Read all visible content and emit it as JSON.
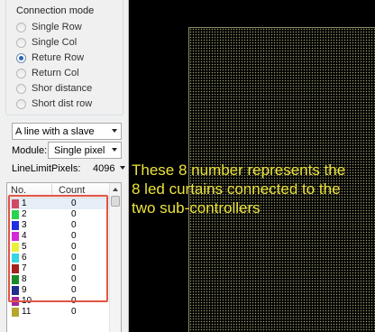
{
  "connection_mode": {
    "title": "Connection mode",
    "options": [
      {
        "label": "Single Row",
        "checked": false
      },
      {
        "label": "Single Col",
        "checked": false
      },
      {
        "label": "Reture Row",
        "checked": true
      },
      {
        "label": "Return Col",
        "checked": false
      },
      {
        "label": "Shor distance",
        "checked": false
      },
      {
        "label": "Short dist row",
        "checked": false
      }
    ]
  },
  "controls": {
    "line_mode_value": "A line with a slave",
    "module_label": "Module:",
    "module_value": "Single pixel",
    "line_limit_label": "LineLimitPixels:",
    "line_limit_value": "4096"
  },
  "list": {
    "header_no": "No.",
    "header_count": "Count",
    "rows": [
      {
        "no": "1",
        "count": "0",
        "color": "#d04a66",
        "selected": true
      },
      {
        "no": "2",
        "count": "0",
        "color": "#29d34f"
      },
      {
        "no": "3",
        "count": "0",
        "color": "#1f2fe0"
      },
      {
        "no": "4",
        "count": "0",
        "color": "#d32ad6"
      },
      {
        "no": "5",
        "count": "0",
        "color": "#eaf03a"
      },
      {
        "no": "6",
        "count": "0",
        "color": "#36d6e6"
      },
      {
        "no": "7",
        "count": "0",
        "color": "#a5221c"
      },
      {
        "no": "8",
        "count": "0",
        "color": "#1a8a2a"
      },
      {
        "no": "9",
        "count": "0",
        "color": "#1f2f90"
      },
      {
        "no": "10",
        "count": "0",
        "color": "#a2289c"
      },
      {
        "no": "11",
        "count": "0",
        "color": "#b8a52e"
      }
    ]
  },
  "annotation": {
    "lines": [
      "These 8 number represents the",
      " 8 led curtains connected to the",
      " two sub-controllers"
    ],
    "color": "#ece33a"
  },
  "highlight_color": "#e05545"
}
